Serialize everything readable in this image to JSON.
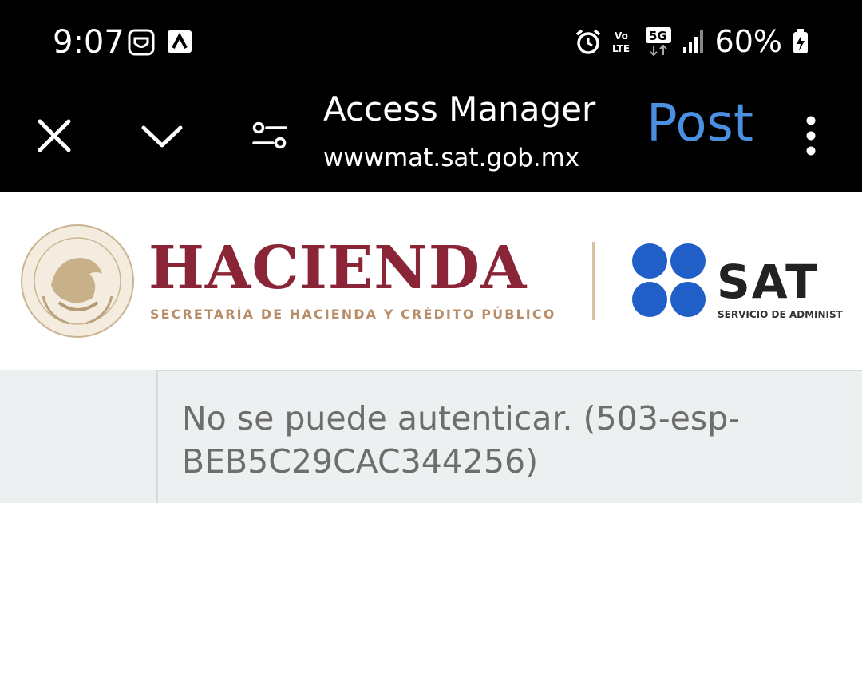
{
  "status_bar": {
    "time": "9:07",
    "battery_text": "60%",
    "network_label": "5G",
    "volte_label": "Vo LTE",
    "icons": [
      "shield-app-icon",
      "arrow-app-icon",
      "alarm-icon",
      "volte-icon",
      "5g-icon",
      "signal-icon",
      "battery-charging-icon"
    ]
  },
  "toolbar": {
    "title": "Access Manager",
    "url": "wwwmat.sat.gob.mx",
    "post_label": "Post",
    "icons": [
      "close-icon",
      "chevron-down-icon",
      "site-settings-icon",
      "more-vert-icon"
    ]
  },
  "banner": {
    "hacienda_title": "HACIENDA",
    "hacienda_subtitle": "SECRETARÍA DE HACIENDA Y CRÉDITO PÚBLICO",
    "sat_title": "SAT",
    "sat_subtitle": "SERVICIO DE ADMINIST",
    "colors": {
      "hacienda": "#8a2538",
      "gold": "#b88e6a",
      "sat_blue": "#1f5fc7"
    }
  },
  "error": {
    "message": "No se puede autenticar. (503-esp-BEB5C29CAC344256)"
  },
  "colors": {
    "accent": "#4a8fe0",
    "error_bg": "#ecf0f1",
    "error_text": "#6e6e6e"
  }
}
